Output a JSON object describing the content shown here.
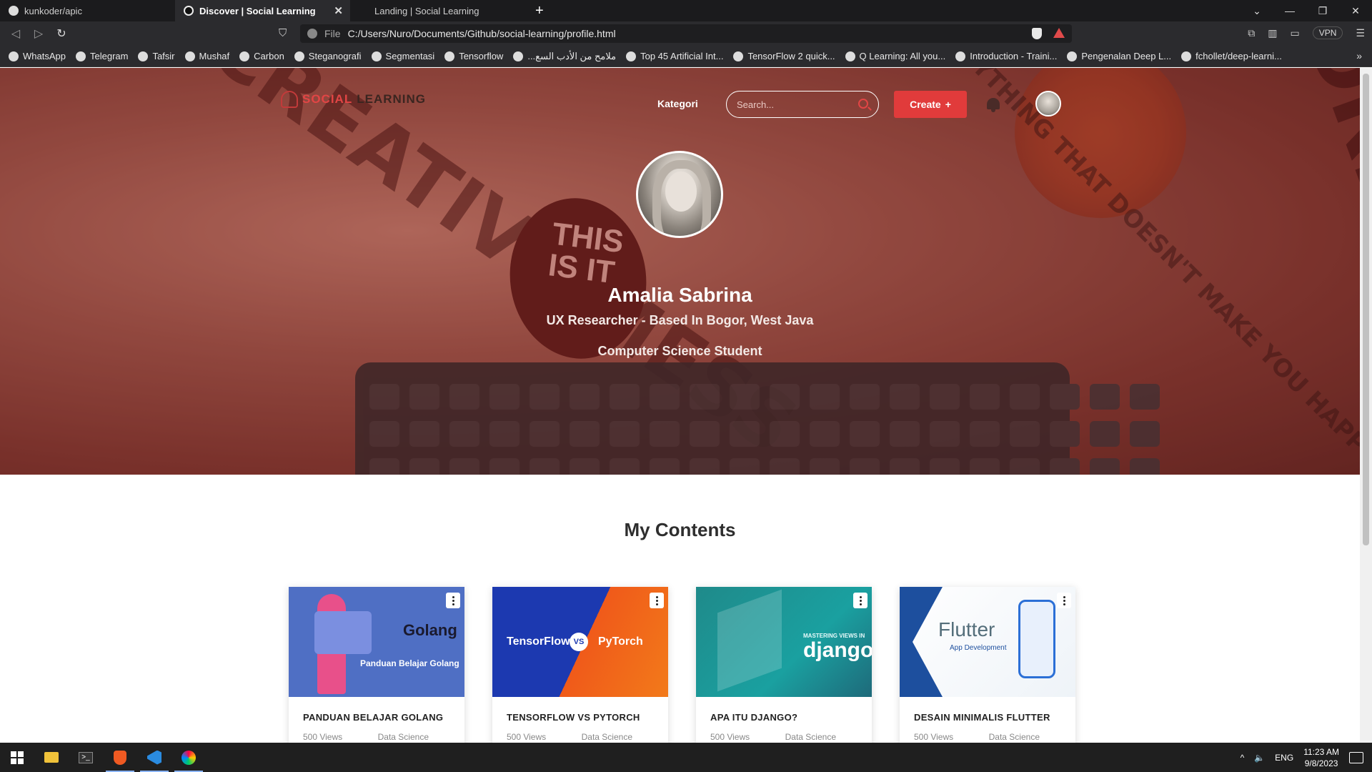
{
  "browser": {
    "tabs": [
      {
        "title": "kunkoder/apic",
        "active": false,
        "icon": "github-icon"
      },
      {
        "title": "Discover | Social Learning",
        "active": true,
        "icon": "social-learning-icon"
      },
      {
        "title": "Landing | Social Learning",
        "active": false,
        "icon": ""
      }
    ],
    "new_tab": "+",
    "url_scheme_label": "File",
    "url": "C:/Users/Nuro/Documents/Github/social-learning/profile.html",
    "vpn_label": "VPN",
    "bookmarks": [
      {
        "label": "WhatsApp",
        "icon": "whatsapp-icon"
      },
      {
        "label": "Telegram",
        "icon": "telegram-icon"
      },
      {
        "label": "Tafsir",
        "icon": "tafsir-icon"
      },
      {
        "label": "Mushaf",
        "icon": "mushaf-icon"
      },
      {
        "label": "Carbon",
        "icon": "carbon-icon"
      },
      {
        "label": "Steganografi",
        "icon": "github-icon"
      },
      {
        "label": "Segmentasi",
        "icon": "medium-icon"
      },
      {
        "label": "Tensorflow",
        "icon": "github-icon"
      },
      {
        "label": "...ملامح من الأدب السع",
        "icon": "globe-icon"
      },
      {
        "label": "Top 45 Artificial Int...",
        "icon": "site-icon"
      },
      {
        "label": "TensorFlow 2 quick...",
        "icon": "tensorflow-icon"
      },
      {
        "label": "Q Learning: All you...",
        "icon": "medium-icon"
      },
      {
        "label": "Introduction - Traini...",
        "icon": "microsoft-icon"
      },
      {
        "label": "Pengenalan Deep L...",
        "icon": "medium-icon"
      },
      {
        "label": "fchollet/deep-learni...",
        "icon": "github-icon"
      }
    ],
    "bookmarks_more": "»"
  },
  "site": {
    "logo_part1": "SOCIAL",
    "logo_part2": "LEARNING",
    "nav_kategori": "Kategori",
    "search_placeholder": "Search...",
    "create_label": "Create",
    "create_icon": "+",
    "accent_color": "#e13b3b"
  },
  "profile": {
    "name": "Amalia Sabrina",
    "role": "UX Researcher - Based In Bogor, West Java",
    "bio": "Computer Science Student"
  },
  "contents": {
    "section_title": "My Contents",
    "cards": [
      {
        "title": "PANDUAN BELAJAR GOLANG",
        "views": "500 Views",
        "category": "Data Science",
        "thumb_line1": "Golang",
        "thumb_line2": "Panduan Belajar Golang"
      },
      {
        "title": "TENSORFLOW VS PYTORCH",
        "views": "500 Views",
        "category": "Data Science",
        "thumb_line1": "TensorFlow",
        "thumb_line2": "PyTorch"
      },
      {
        "title": "APA ITU DJANGO?",
        "views": "500 Views",
        "category": "Data Science",
        "thumb_line1": "django",
        "thumb_line2": "MASTERING VIEWS IN"
      },
      {
        "title": "DESAIN MINIMALIS FLUTTER",
        "views": "500 Views",
        "category": "Data Science",
        "thumb_line1": "Flutter",
        "thumb_line2": "App Development"
      }
    ]
  },
  "hero_decor": {
    "d1": "CREATIVE MESS",
    "d2": "F**K ANYTHING THAT DOESN'T MAKE YOU HAPPY.",
    "d3": "MORE IMPORTANT",
    "circle": "THIS IS IT"
  },
  "taskbar": {
    "lang": "ENG",
    "time": "11:23 AM",
    "date": "9/8/2023"
  }
}
